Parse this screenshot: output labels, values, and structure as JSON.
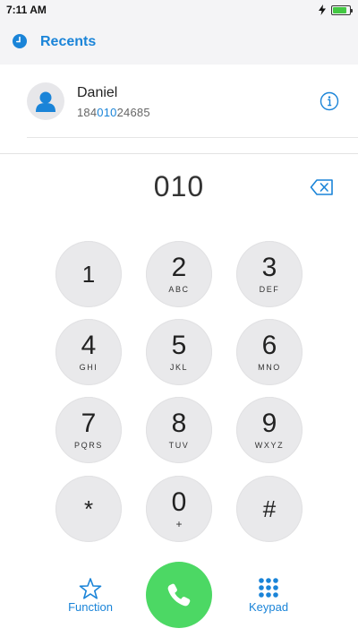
{
  "status_bar": {
    "time": "7:11 AM",
    "battery_level": 0.85,
    "charging_icon": "bolt-icon",
    "battery_color": "#43c843"
  },
  "header": {
    "icon": "clock-icon",
    "title": "Recents"
  },
  "recent": {
    "name": "Daniel",
    "number_prefix": "184",
    "number_match": "010",
    "number_suffix": "24685",
    "info_icon": "info-icon"
  },
  "dialer": {
    "entered_number": "010",
    "backspace_icon": "backspace-icon"
  },
  "keypad": {
    "k1": {
      "digit": "1",
      "letters": ""
    },
    "k2": {
      "digit": "2",
      "letters": "ABC"
    },
    "k3": {
      "digit": "3",
      "letters": "DEF"
    },
    "k4": {
      "digit": "4",
      "letters": "GHI"
    },
    "k5": {
      "digit": "5",
      "letters": "JKL"
    },
    "k6": {
      "digit": "6",
      "letters": "MNO"
    },
    "k7": {
      "digit": "7",
      "letters": "PQRS"
    },
    "k8": {
      "digit": "8",
      "letters": "TUV"
    },
    "k9": {
      "digit": "9",
      "letters": "WXYZ"
    },
    "kstar": {
      "digit": "*",
      "letters": ""
    },
    "k0": {
      "digit": "0",
      "letters": "+"
    },
    "khash": {
      "digit": "#",
      "letters": ""
    }
  },
  "bottom": {
    "function_label": "Function",
    "function_icon": "star-icon",
    "call_icon": "phone-icon",
    "keypad_label": "Keypad",
    "keypad_icon": "keypad-grid-icon"
  },
  "colors": {
    "accent": "#1a84d8",
    "call_green": "#4cd864",
    "key_bg": "#e9e9eb"
  }
}
